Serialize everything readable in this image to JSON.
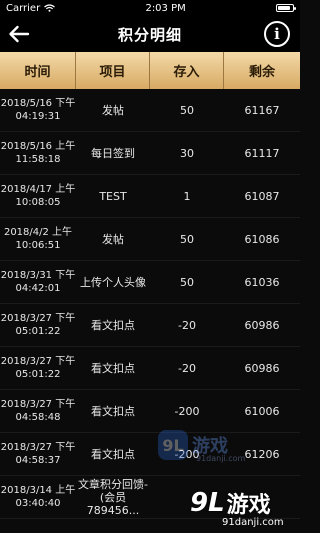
{
  "status_bar": {
    "carrier": "Carrier",
    "time": "2:03 PM"
  },
  "nav": {
    "title": "积分明细",
    "back_icon": "arrow-left-icon",
    "info_icon": "info-circle-icon",
    "info_glyph": "i"
  },
  "table": {
    "headers": [
      "时间",
      "项目",
      "存入",
      "剩余"
    ],
    "rows": [
      {
        "date": "2018/5/16 下午",
        "clock": "04:19:31",
        "item": "发帖",
        "in": "50",
        "remain": "61167"
      },
      {
        "date": "2018/5/16 上午",
        "clock": "11:58:18",
        "item": "每日签到",
        "in": "30",
        "remain": "61117"
      },
      {
        "date": "2018/4/17 上午",
        "clock": "10:08:05",
        "item": "TEST",
        "in": "1",
        "remain": "61087"
      },
      {
        "date": "2018/4/2 上午",
        "clock": "10:06:51",
        "item": "发帖",
        "in": "50",
        "remain": "61086"
      },
      {
        "date": "2018/3/31 下午",
        "clock": "04:42:01",
        "item": "上传个人头像",
        "in": "50",
        "remain": "61036"
      },
      {
        "date": "2018/3/27 下午",
        "clock": "05:01:22",
        "item": "看文扣点",
        "in": "-20",
        "remain": "60986"
      },
      {
        "date": "2018/3/27 下午",
        "clock": "05:01:22",
        "item": "看文扣点",
        "in": "-20",
        "remain": "60986"
      },
      {
        "date": "2018/3/27 下午",
        "clock": "04:58:48",
        "item": "看文扣点",
        "in": "-200",
        "remain": "61006"
      },
      {
        "date": "2018/3/27 下午",
        "clock": "04:58:37",
        "item": "看文扣点",
        "in": "-200",
        "remain": "61206"
      },
      {
        "date": "2018/3/14 上午",
        "clock": "03:40:40",
        "item": "文章积分回馈-(会员 789456...",
        "in": "",
        "remain": ""
      }
    ]
  },
  "watermark": {
    "logo": "9L",
    "name": "游戏",
    "domain": "91danji.com"
  },
  "colors": {
    "header_gradient_top": "#f3d9a8",
    "header_gradient_bottom": "#d7aa63",
    "background": "#0b0b0b"
  }
}
